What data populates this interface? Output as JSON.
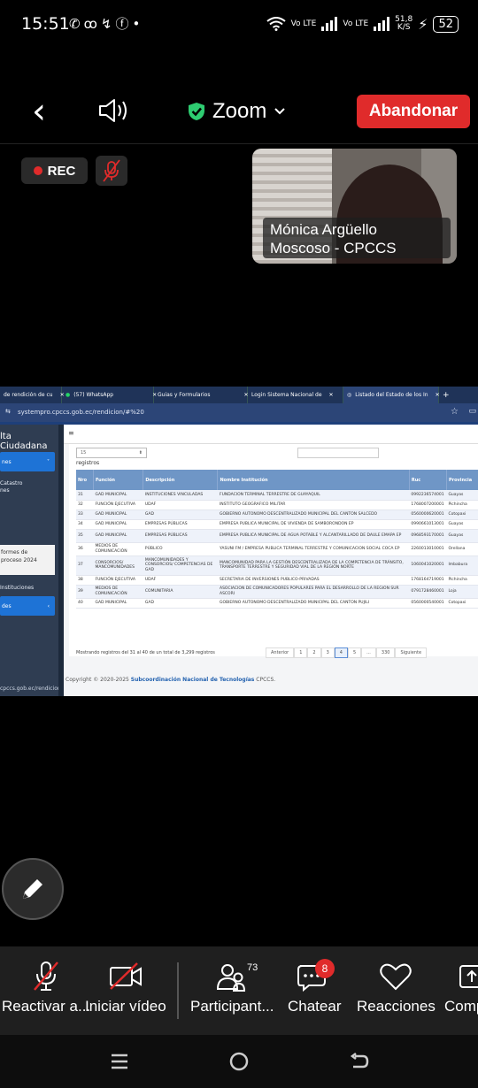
{
  "status_bar": {
    "time": "15:51",
    "net1": "Vo LTE",
    "net2": "Vo LTE",
    "speed_value": "51,8",
    "speed_unit": "K/S",
    "battery": "52"
  },
  "zoom": {
    "title": "Zoom",
    "leave_label": "Abandonar",
    "rec_label": "REC",
    "participant_name_line1": "Mónica Argüello",
    "participant_name_line2": "Moscoso - CPCCS"
  },
  "browser": {
    "tabs": [
      {
        "label": "de rendición de cu"
      },
      {
        "label": "(57) WhatsApp"
      },
      {
        "label": "Guias y Formularios"
      },
      {
        "label": "Login Sistema Nacional de"
      },
      {
        "label": "Listado del Estado de los In"
      }
    ],
    "new_tab": "+",
    "url": "systempro.cpccs.gob.ec/rendicion/#%20"
  },
  "sidebar": {
    "title": "lta Ciudadana",
    "btn1": "nes",
    "item1_line1": "Catastro",
    "item1_line2": "nes",
    "card_line1": "formes de",
    "card_line2": "proceso 2024",
    "item2": "Instituciones",
    "btn2": "des",
    "footer_url": "cpccs.gob.ec/rendicion/#"
  },
  "table": {
    "page_size": "15",
    "registros_label": "registros",
    "headers": [
      "Nro",
      "Función",
      "Descripción",
      "Nombre Institución",
      "Ruc",
      "Provincia"
    ],
    "rows": [
      [
        "31",
        "GAD MUNICIPAL",
        "INSTITUCIONES VINCULADAS",
        "FUNDACION TERMINAL TERRESTRE DE GUAYAQUIL",
        "0992236574001",
        "Guayas"
      ],
      [
        "32",
        "FUNCIÓN EJECUTIVA",
        "UDAF",
        "INSTITUTO GEOGRAFICO MILITAR",
        "1768007200001",
        "Pichincha"
      ],
      [
        "33",
        "GAD MUNICIPAL",
        "GAD",
        "GOBIERNO AUTONOMO DESCENTRALIZADO MUNICIPAL DEL CANTON SALCEDO",
        "0560000620001",
        "Cotopaxi"
      ],
      [
        "34",
        "GAD MUNICIPAL",
        "EMPRESAS PÚBLICAS",
        "EMPRESA PUBLICA MUNICIPAL DE VIVIENDA DE SAMBORONDON EP",
        "0990661013001",
        "Guayas"
      ],
      [
        "35",
        "GAD MUNICIPAL",
        "EMPRESAS PÚBLICAS",
        "EMPRESA PUBLICA MUNICIPAL DE AGUA POTABLE Y ALCANTARILLADO DE DAULE EMAPA EP",
        "0968593170001",
        "Guayas"
      ],
      [
        "36",
        "MEDIOS DE COMUNICACIÓN",
        "PÚBLICO",
        "YASUNI FM / EMPRESA PUBLICA TERMINAL TERRESTRE Y COMUNICACION SOCIAL COCA EP",
        "2260013010001",
        "Orellana"
      ],
      [
        "37",
        "CONSORCIOS/ MANCOMUNIDADES",
        "MANCOMUNIDADES Y CONSORCIOS/ COMPETENCIAS DE GAD",
        "MANCOMUNIDAD PARA LA GESTIÓN DESCENTRALIZADA DE LA COMPETENCIA DE TRÁNSITO, TRANSPORTE TERRESTRE Y SEGURIDAD VIAL DE LA REGIÓN NORTE",
        "1060041020001",
        "Imbabura"
      ],
      [
        "38",
        "FUNCIÓN EJECUTIVA",
        "UDAF",
        "SECRETARIA DE INVERSIONES PUBLICO-PRIVADAS",
        "1768164719001",
        "Pichincha"
      ],
      [
        "39",
        "MEDIOS DE COMUNICACIÓN",
        "COMUNITARIA",
        "ASOCIACION DE COMUNICADORES POPULARES PARA EL DESARROLLO DE LA REGION SUR ASCORI",
        "0791728460001",
        "Loja"
      ],
      [
        "40",
        "GAD MUNICIPAL",
        "GAD",
        "GOBIERNO AUTONOMO DESCENTRALIZADO MUNICIPAL DEL CANTON PUJILI",
        "0560000540001",
        "Cotopaxi"
      ]
    ],
    "showing_text": "Mostrando registros del 31 al 40 de un total de 3,299 registros",
    "pager": [
      "Anterior",
      "1",
      "2",
      "3",
      "4",
      "5",
      "...",
      "330",
      "Siguiente"
    ],
    "active_page": "4"
  },
  "footer": {
    "prefix": "Copyright © 2020-2025",
    "link": "Subcoordinación Nacional de Tecnologías",
    "suffix": "CPCCS."
  },
  "toolbar": {
    "unmute_label": "Reactivar a...",
    "video_label": "Iniciar vídeo",
    "participants_label": "Participant...",
    "participants_count": "73",
    "chat_label": "Chatear",
    "chat_badge": "8",
    "reactions_label": "Reacciones",
    "share_label": "Comp"
  },
  "colors": {
    "leave_red": "#e02b2b",
    "shield_green": "#2ecc71",
    "table_header": "#6f96c6",
    "sidebar_blue": "#1e73d6"
  }
}
